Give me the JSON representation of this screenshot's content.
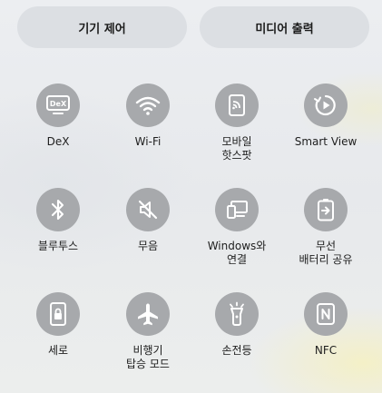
{
  "header": {
    "device_control_label": "기기 제어",
    "media_output_label": "미디어 출력"
  },
  "tiles": [
    {
      "id": "dex",
      "icon": "dex-icon",
      "line1": "DeX",
      "line2": ""
    },
    {
      "id": "wifi",
      "icon": "wifi-icon",
      "line1": "Wi-Fi",
      "line2": ""
    },
    {
      "id": "hotspot",
      "icon": "hotspot-icon",
      "line1": "모바일",
      "line2": "핫스팟"
    },
    {
      "id": "smartview",
      "icon": "smart-view-icon",
      "line1": "Smart View",
      "line2": ""
    },
    {
      "id": "bluetooth",
      "icon": "bluetooth-icon",
      "line1": "블루투스",
      "line2": ""
    },
    {
      "id": "mute",
      "icon": "mute-icon",
      "line1": "무음",
      "line2": ""
    },
    {
      "id": "windows",
      "icon": "link-to-windows-icon",
      "line1": "Windows와",
      "line2": "연결"
    },
    {
      "id": "powershare",
      "icon": "wireless-powershare-icon",
      "line1": "무선",
      "line2": "배터리 공유"
    },
    {
      "id": "portrait",
      "icon": "portrait-lock-icon",
      "line1": "세로",
      "line2": ""
    },
    {
      "id": "airplane",
      "icon": "airplane-icon",
      "line1": "비행기",
      "line2": "탑승 모드"
    },
    {
      "id": "flashlight",
      "icon": "flashlight-icon",
      "line1": "손전등",
      "line2": ""
    },
    {
      "id": "nfc",
      "icon": "nfc-icon",
      "line1": "NFC",
      "line2": ""
    }
  ],
  "colors": {
    "icon_bg": "#a7a9ac",
    "icon_fg": "#ffffff",
    "pill_bg": "#dcdfe3"
  }
}
